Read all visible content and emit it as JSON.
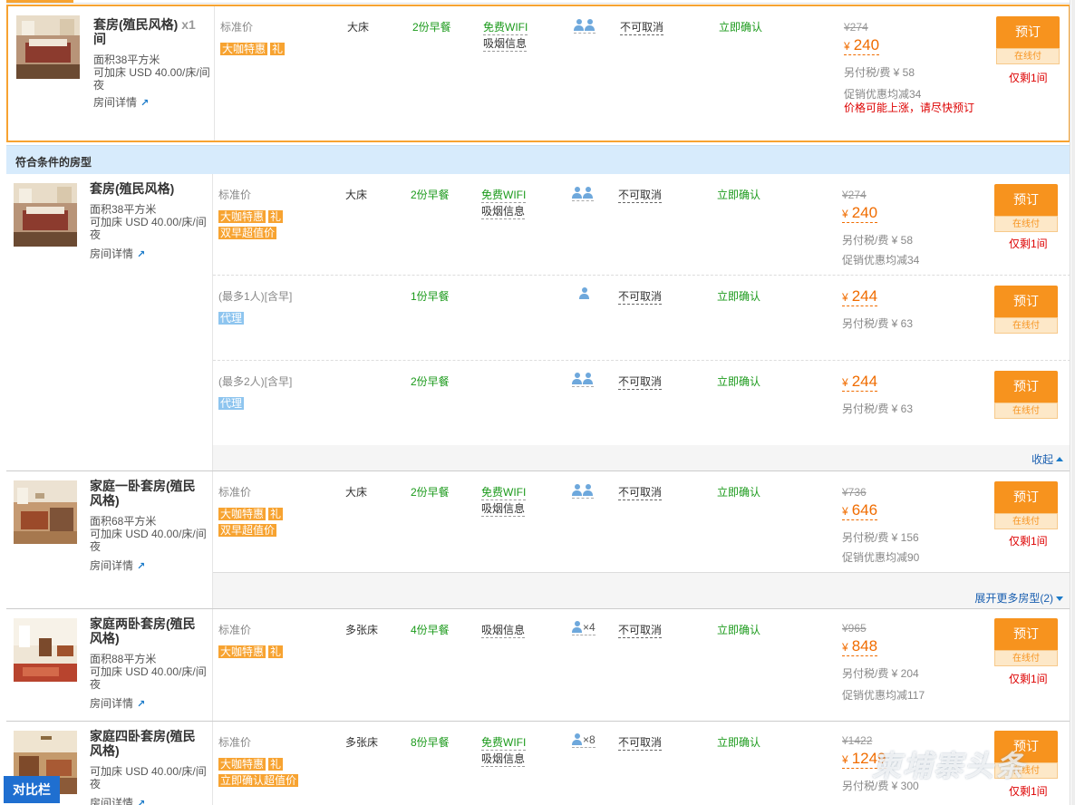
{
  "featured": {
    "room_name": "套房(殖民风格)",
    "qty": "x1",
    "qty_unit": "间",
    "area": "面积38平方米",
    "extra_bed": "可加床 USD 40.00/床/间夜",
    "detail_link": "房间详情",
    "plan": "标准价",
    "tags": [
      "大咖特惠",
      "礼"
    ],
    "bed": "大床",
    "breakfast": "2份早餐",
    "wifi": "免费WIFI",
    "smoke": "吸烟信息",
    "cancel": "不可取消",
    "confirm": "立即确认",
    "orig_price": "¥274",
    "currency": "¥",
    "price": "240",
    "tax": "另付税/费 ¥ 58",
    "promo": "促销优惠均减34",
    "warning": "价格可能上涨，请尽快预订",
    "book": "预订",
    "online": "在线付",
    "left": "仅剩1间"
  },
  "section_title": "符合条件的房型",
  "rooms": [
    {
      "name": "套房(殖民风格)",
      "area": "面积38平方米",
      "extra_bed": "可加床 USD 40.00/床/间夜",
      "detail_link": "房间详情",
      "plans": [
        {
          "plan": "标准价",
          "tags": [
            "大咖特惠",
            "礼"
          ],
          "tags2": [
            "双早超值价"
          ],
          "bed": "大床",
          "breakfast": "2份早餐",
          "wifi": "免费WIFI",
          "smoke": "吸烟信息",
          "guests": 2,
          "cancel": "不可取消",
          "confirm": "立即确认",
          "orig_price": "¥274",
          "price": "240",
          "tax": "另付税/费 ¥ 58",
          "promo": "促销优惠均减34",
          "left": "仅剩1间"
        },
        {
          "plan": "(最多1人)[含早]",
          "tags": [
            "代理"
          ],
          "breakfast": "1份早餐",
          "guests": 1,
          "cancel": "不可取消",
          "confirm": "立即确认",
          "price": "244",
          "tax": "另付税/费 ¥ 63"
        },
        {
          "plan": "(最多2人)[含早]",
          "tags": [
            "代理"
          ],
          "breakfast": "2份早餐",
          "guests": 2,
          "cancel": "不可取消",
          "confirm": "立即确认",
          "price": "244",
          "tax": "另付税/费 ¥ 63"
        }
      ],
      "footer_link": "收起"
    },
    {
      "name": "家庭一卧套房(殖民风格)",
      "area": "面积68平方米",
      "extra_bed": "可加床 USD 40.00/床/间夜",
      "detail_link": "房间详情",
      "plans": [
        {
          "plan": "标准价",
          "tags": [
            "大咖特惠",
            "礼"
          ],
          "tags2": [
            "双早超值价"
          ],
          "bed": "大床",
          "breakfast": "2份早餐",
          "wifi": "免费WIFI",
          "smoke": "吸烟信息",
          "guests": 2,
          "cancel": "不可取消",
          "confirm": "立即确认",
          "orig_price": "¥736",
          "price": "646",
          "tax": "另付税/费 ¥ 156",
          "promo": "促销优惠均减90",
          "left": "仅剩1间"
        }
      ],
      "footer_link": "展开更多房型(2)"
    },
    {
      "name": "家庭两卧套房(殖民风格)",
      "area": "面积88平方米",
      "extra_bed": "可加床 USD 40.00/床/间夜",
      "detail_link": "房间详情",
      "plans": [
        {
          "plan": "标准价",
          "tags": [
            "大咖特惠",
            "礼"
          ],
          "bed": "多张床",
          "breakfast": "4份早餐",
          "smoke": "吸烟信息",
          "guests_text": "×4",
          "cancel": "不可取消",
          "confirm": "立即确认",
          "orig_price": "¥965",
          "price": "848",
          "tax": "另付税/费 ¥ 204",
          "promo": "促销优惠均减117",
          "left": "仅剩1间"
        }
      ]
    },
    {
      "name": "家庭四卧套房(殖民风格)",
      "extra_bed": "可加床 USD 40.00/床/间夜",
      "detail_link": "房间详情",
      "plans": [
        {
          "plan": "标准价",
          "tags": [
            "大咖特惠",
            "礼"
          ],
          "tags2": [
            "立即确认超值价"
          ],
          "bed": "多张床",
          "breakfast": "8份早餐",
          "wifi": "免费WIFI",
          "smoke": "吸烟信息",
          "guests_text": "×8",
          "cancel": "不可取消",
          "confirm": "立即确认",
          "orig_price": "¥1422",
          "price": "1249",
          "tax": "另付税/费 ¥ 300",
          "left": "仅剩1间"
        }
      ]
    }
  ],
  "compare_bar": "对比栏",
  "watermark": "柬埔寨头条",
  "colors": {
    "accent": "#f7a331",
    "price": "#f06c00",
    "green": "#1b9a1b",
    "section_bg": "#d7ebfc",
    "link": "#1a5fb0"
  }
}
